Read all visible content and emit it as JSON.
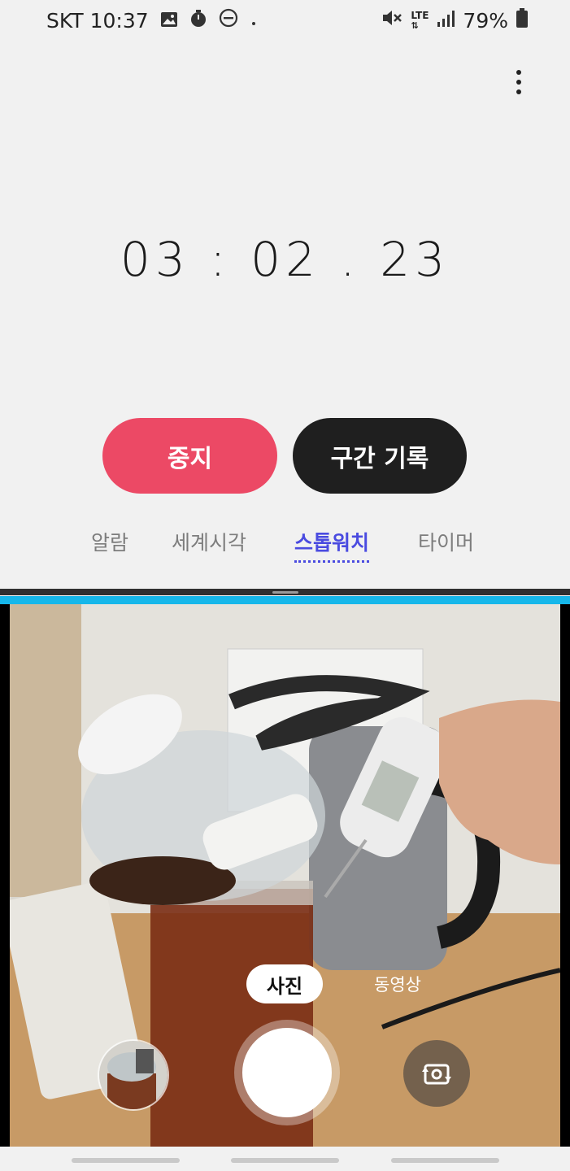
{
  "status_bar": {
    "carrier": "SKT",
    "time": "10:37",
    "battery": "79%",
    "network": "LTE"
  },
  "stopwatch": {
    "time": "03 : 02 . 23",
    "stop_label": "중지",
    "lap_label": "구간 기록",
    "stop_color": "#ec4965",
    "lap_color": "#1f1f1f"
  },
  "tabs": [
    {
      "label": "알람",
      "active": false
    },
    {
      "label": "세계시각",
      "active": false
    },
    {
      "label": "스톱워치",
      "active": true
    },
    {
      "label": "타이머",
      "active": false
    }
  ],
  "camera": {
    "mode_photo": "사진",
    "mode_video": "동영상",
    "accent": "#16b7ea"
  },
  "icons": [
    "gallery-icon",
    "timer-icon",
    "dnd-icon",
    "mute-icon",
    "signal-icon",
    "battery-icon",
    "more-options-icon",
    "switch-camera-icon"
  ]
}
